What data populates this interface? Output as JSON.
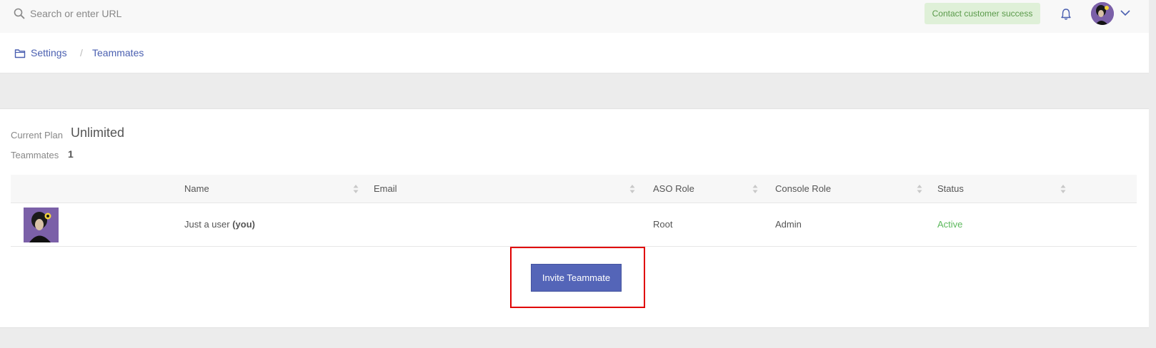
{
  "topbar": {
    "search_placeholder": "Search or enter URL",
    "contact_label": "Contact customer success",
    "icons": [
      "search-icon",
      "bell-icon",
      "avatar",
      "chevron-down-icon"
    ]
  },
  "breadcrumb": {
    "items": [
      "Settings",
      "Teammates"
    ],
    "separator": "/"
  },
  "plan": {
    "label": "Current Plan",
    "value": "Unlimited",
    "teammates_label": "Teammates",
    "teammates_count": "1"
  },
  "table": {
    "columns": [
      "Name",
      "Email",
      "ASO Role",
      "Console Role",
      "Status"
    ],
    "rows": [
      {
        "name": "Just a user",
        "name_suffix": "(you)",
        "email": "",
        "aso_role": "Root",
        "console_role": "Admin",
        "status": "Active"
      }
    ]
  },
  "actions": {
    "invite_label": "Invite Teammate"
  },
  "colors": {
    "accent": "#5465b8",
    "link": "#4a5fb0",
    "status_active": "#5cb85c",
    "contact_bg": "#dff0d8",
    "highlight": "#e00000"
  }
}
